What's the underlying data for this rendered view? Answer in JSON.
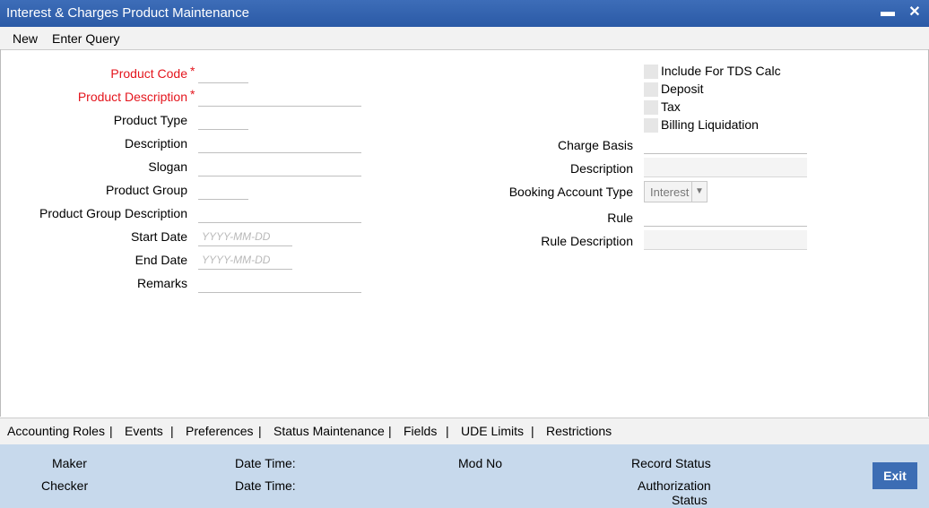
{
  "window": {
    "title": "Interest & Charges Product Maintenance",
    "minimize_glyph": "▬",
    "close_glyph": "✕"
  },
  "menu": {
    "new": "New",
    "enter_query": "Enter Query"
  },
  "left_form": {
    "product_code": "Product Code",
    "product_description": "Product Description",
    "required_mark": "*",
    "product_type": "Product Type",
    "description": "Description",
    "slogan": "Slogan",
    "product_group": "Product Group",
    "product_group_description": "Product Group Description",
    "start_date": "Start Date",
    "end_date": "End Date",
    "remarks": "Remarks",
    "date_placeholder": "YYYY-MM-DD"
  },
  "right_form": {
    "include_tds": "Include For TDS Calc",
    "deposit": "Deposit",
    "tax": "Tax",
    "billing_liquidation": "Billing Liquidation",
    "charge_basis": "Charge Basis",
    "description": "Description",
    "booking_account_type": "Booking Account Type",
    "booking_account_value": "Interest",
    "rule": "Rule",
    "rule_description": "Rule Description"
  },
  "tabs": [
    "Accounting Roles",
    "|",
    "Events",
    "|",
    "Preferences",
    "|",
    "Status Maintenance",
    "|",
    "Fields",
    "|",
    "UDE Limits",
    "|",
    "Restrictions"
  ],
  "footer": {
    "maker": "Maker",
    "checker": "Checker",
    "date_time_1": "Date Time:",
    "date_time_2": "Date Time:",
    "mod_no": "Mod No",
    "record_status": "Record Status",
    "authorization": "Authorization",
    "status": "Status",
    "exit": "Exit"
  },
  "colors": {
    "titlebar": "#2b5aa6",
    "required": "#e4151d",
    "footer": "#c7d9ec",
    "exit_button": "#3c6db4"
  }
}
